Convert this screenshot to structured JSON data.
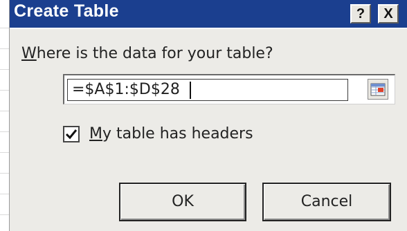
{
  "dialog": {
    "title": "Create Table",
    "help_label": "?",
    "close_label": "X",
    "prompt_text": "here is the data for your table?",
    "prompt_mnemonic": "W",
    "range_value": "=$A$1:$D$28",
    "headers_checked": true,
    "headers_mnemonic": "M",
    "headers_label": "y table has headers",
    "ok_label": "OK",
    "cancel_label": "Cancel"
  },
  "icons": {
    "help": "question-mark",
    "close": "close-x",
    "collapse_dialog": "range-select-grid",
    "checkbox": "checkmark"
  },
  "colors": {
    "title_bar": "#1b3f8f",
    "dialog_background": "#ecebe7",
    "text": "#222222"
  }
}
